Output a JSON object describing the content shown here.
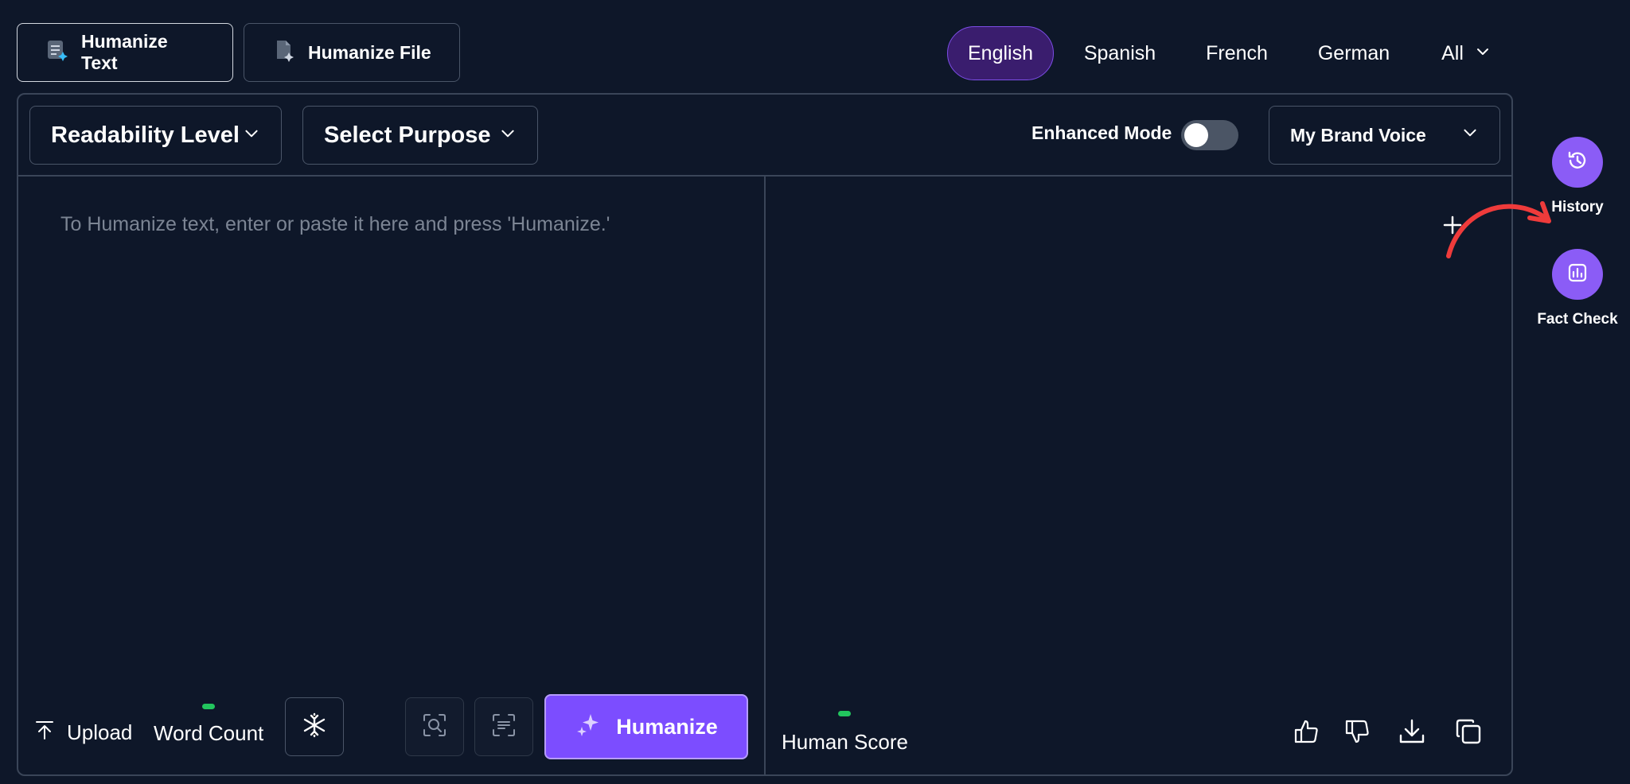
{
  "tabs": {
    "humanize_text": "Humanize Text",
    "humanize_file": "Humanize File"
  },
  "languages": {
    "english": "English",
    "spanish": "Spanish",
    "french": "French",
    "german": "German",
    "all": "All"
  },
  "toolbar": {
    "readability": "Readability Level",
    "purpose": "Select Purpose",
    "enhanced_mode": "Enhanced Mode",
    "enhanced_mode_on": false,
    "brand_voice": "My Brand Voice"
  },
  "editor": {
    "placeholder": "To Humanize text, enter or paste it here and press 'Humanize.'"
  },
  "bottom": {
    "upload": "Upload",
    "word_count": "Word Count",
    "humanize": "Humanize",
    "human_score": "Human Score"
  },
  "side": {
    "history": "History",
    "fact_check": "Fact Check"
  },
  "colors": {
    "background": "#0e1729",
    "accent": "#7c4dff",
    "side_button": "#8b5cf6",
    "active_language": "#3a1d6e",
    "indicator": "#22c55e",
    "arrow": "#ef3b3b"
  },
  "icons": [
    "humanize-text-icon",
    "humanize-file-icon",
    "chevron-down-icon",
    "plus-icon",
    "upload-icon",
    "snowflake-icon",
    "scan-icon",
    "text-align-icon",
    "sparkles-icon",
    "thumbs-up-icon",
    "thumbs-down-icon",
    "download-icon",
    "copy-icon",
    "history-icon",
    "chart-icon",
    "curved-arrow-icon"
  ]
}
